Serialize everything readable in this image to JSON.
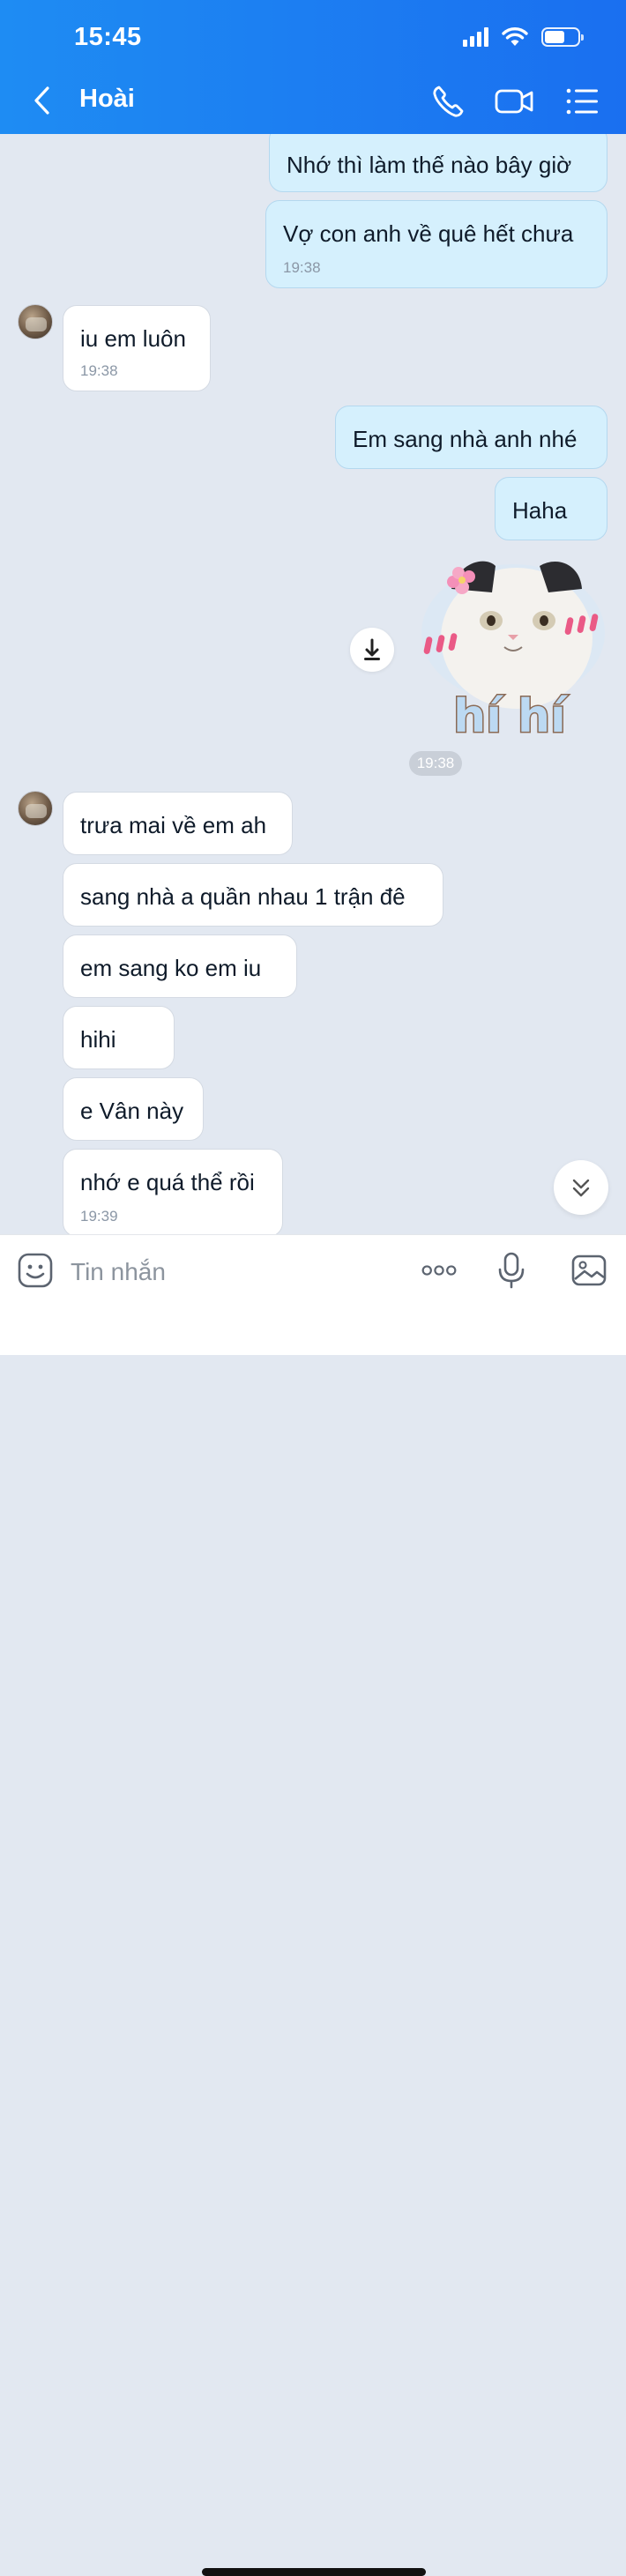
{
  "status_bar": {
    "time": "15:45"
  },
  "header": {
    "contact_name": "Hoài"
  },
  "messages": [
    {
      "dir": "out",
      "text": "Nhớ thì làm thế nào bây giờ"
    },
    {
      "dir": "out",
      "text": "Vợ con anh về quê hết chưa",
      "time": "19:38"
    },
    {
      "dir": "in",
      "text": "iu em luôn",
      "time": "19:38"
    },
    {
      "dir": "out",
      "text": "Em sang nhà anh nhé"
    },
    {
      "dir": "out",
      "text": "Haha"
    },
    {
      "dir": "in",
      "text": "trưa mai về em ah"
    },
    {
      "dir": "in",
      "text": "sang nhà a quần nhau 1 trận đê"
    },
    {
      "dir": "in",
      "text": "em sang ko em iu"
    },
    {
      "dir": "in",
      "text": "hihi"
    },
    {
      "dir": "in",
      "text": "e Vân này"
    },
    {
      "dir": "in",
      "text": "nhớ e quá thể rồi",
      "time": "19:39"
    }
  ],
  "sticker": {
    "text": "hí hí",
    "time": "19:38"
  },
  "input": {
    "placeholder": "Tin nhắn"
  },
  "colors": {
    "header_blue": "#1a82f2",
    "outgoing_bubble": "#d5f0fd",
    "incoming_bubble": "#ffffff",
    "chat_background": "#e2e8f1"
  },
  "icons": {
    "back": "chevron-left-icon",
    "call": "phone-icon",
    "video": "video-camera-icon",
    "menu": "list-menu-icon",
    "emoji": "emoji-icon",
    "more": "more-dots-icon",
    "mic": "microphone-icon",
    "gallery": "image-icon",
    "download": "download-icon",
    "scroll": "double-chevron-down-icon"
  }
}
